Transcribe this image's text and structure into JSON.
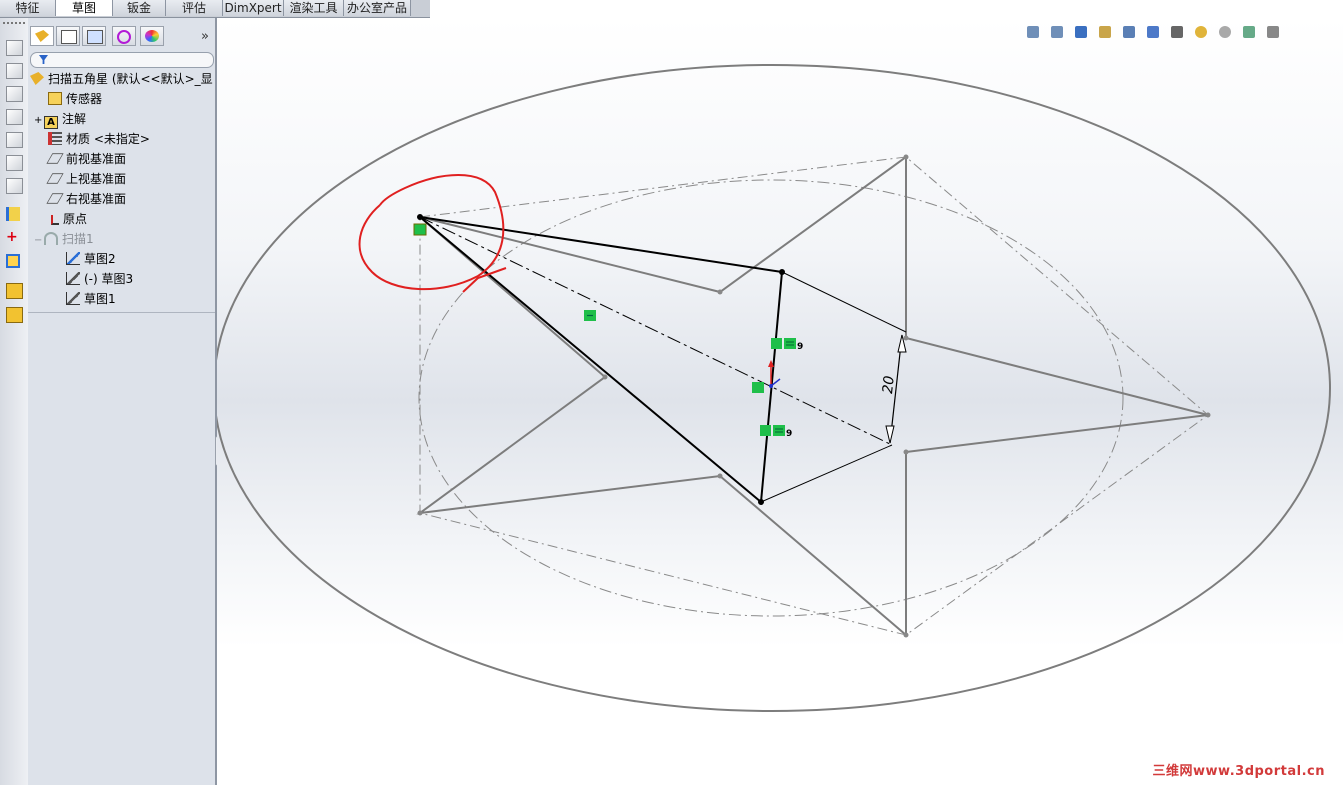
{
  "tabs": [
    {
      "label": "特征",
      "active": false
    },
    {
      "label": "草图",
      "active": true
    },
    {
      "label": "钣金",
      "active": false
    },
    {
      "label": "评估",
      "active": false
    },
    {
      "label": "DimXpert",
      "active": false
    },
    {
      "label": "渲染工具",
      "active": false
    },
    {
      "label": "办公室产品",
      "active": false
    }
  ],
  "panel": {
    "collapse_glyph": "»",
    "tree": [
      {
        "label": "扫描五角星 (默认<<默认>_显",
        "icon": "part-icon",
        "dim": false
      },
      {
        "label": "传感器",
        "icon": "sensor-icon",
        "dim": false
      },
      {
        "label": "注解",
        "icon": "annotation-icon",
        "dim": false,
        "expand": "+"
      },
      {
        "label": "材质 <未指定>",
        "icon": "material-icon",
        "dim": false
      },
      {
        "label": "前视基准面",
        "icon": "plane-icon",
        "dim": false
      },
      {
        "label": "上视基准面",
        "icon": "plane-icon",
        "dim": false
      },
      {
        "label": "右视基准面",
        "icon": "plane-icon",
        "dim": false
      },
      {
        "label": "原点",
        "icon": "origin-icon",
        "dim": false
      },
      {
        "label": "扫描1",
        "icon": "sweep-icon",
        "dim": true,
        "expand": "−"
      },
      {
        "label": "草图2",
        "icon": "sketch-icon",
        "dim": false
      },
      {
        "label": "(-) 草图3",
        "icon": "sketch-icon",
        "dim": false
      },
      {
        "label": "草图1",
        "icon": "sketch-icon",
        "dim": false
      }
    ]
  },
  "view_toolbar": [
    "zoom-fit-icon",
    "zoom-area-icon",
    "previous-view-icon",
    "section-view-icon",
    "view-orientation-icon",
    "display-style-icon",
    "hide-show-icon",
    "appearance-icon",
    "scene-icon",
    "view-settings-icon",
    "screen-capture-icon"
  ],
  "sketch": {
    "dimension": "20",
    "relation_marks": [
      {
        "label": "9"
      },
      {
        "label": "9"
      }
    ]
  },
  "colors": {
    "sketch_black": "#000000",
    "geometry_gray": "#7d7d7d",
    "highlight_red": "#e02020",
    "relation_green": "#1fbf4a"
  },
  "watermark": "三维网www.3dportal.cn"
}
